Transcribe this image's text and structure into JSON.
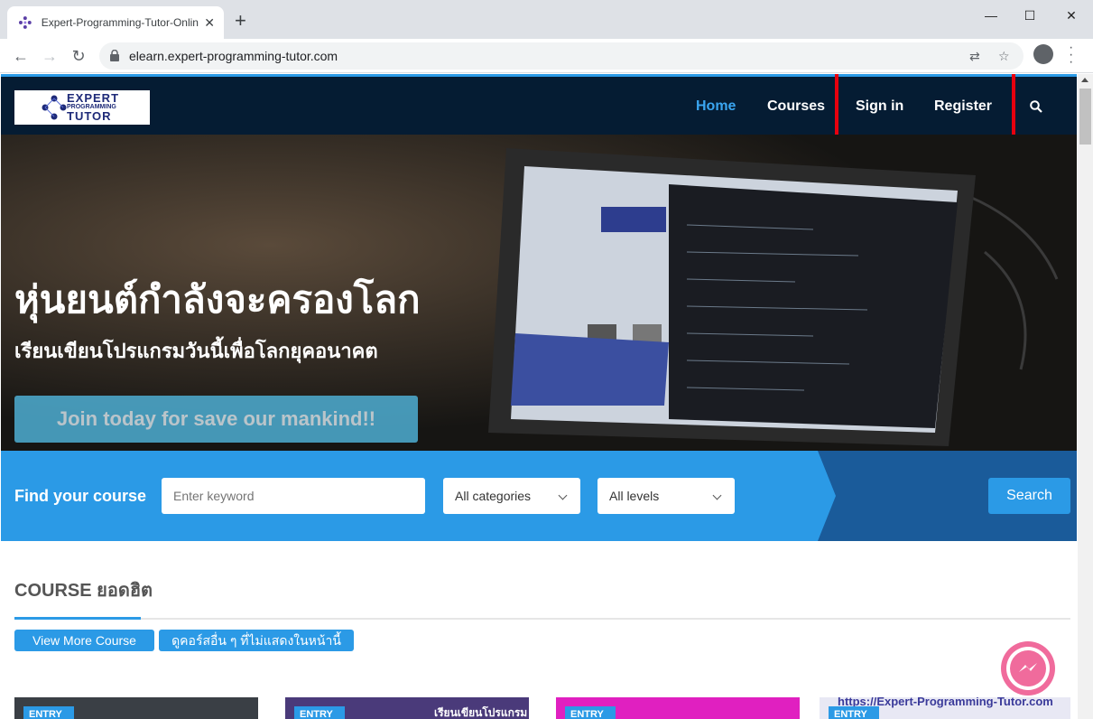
{
  "browser": {
    "tab_title": "Expert-Programming-Tutor-Online",
    "tab_close": "✕",
    "new_tab": "+",
    "url": "elearn.expert-programming-tutor.com",
    "window_minimize": "—",
    "window_maximize": "☐",
    "window_close": "✕"
  },
  "site": {
    "logo_line1": "EXPERT",
    "logo_line2": "PROGRAMMING",
    "logo_line3": "TUTOR",
    "nav": [
      {
        "label": "Home"
      },
      {
        "label": "Courses"
      },
      {
        "label": "Sign in"
      },
      {
        "label": "Register"
      }
    ],
    "accent_color": "#2b9ae6",
    "header_color": "#051c33",
    "highlight_color": "#e8000e"
  },
  "hero": {
    "title": "หุ่นยนต์กำลังจะครองโลก",
    "subtitle": "เรียนเขียนโปรแกรมวันนี้เพื่อโลกยุคอนาคต",
    "cta": "Join today for save our mankind!!"
  },
  "finder": {
    "label": "Find your course",
    "keyword_placeholder": "Enter keyword",
    "category_value": "All categories",
    "level_value": "All levels",
    "search_label": "Search"
  },
  "section": {
    "title": "COURSE ยอดฮิต",
    "view_more": "View More Course",
    "other_courses": "ดูคอร์สอื่น ๆ ที่ไม่แสดงในหน้านี้"
  },
  "cards": [
    {
      "tag": "ENTRY",
      "banner_text": ""
    },
    {
      "tag": "ENTRY",
      "banner_text": "เรียนเขียนโปรแกรม"
    },
    {
      "tag": "ENTRY",
      "banner_text": ""
    },
    {
      "tag": "ENTRY",
      "banner_text": "https://Expert-Programming-Tutor.com"
    }
  ]
}
